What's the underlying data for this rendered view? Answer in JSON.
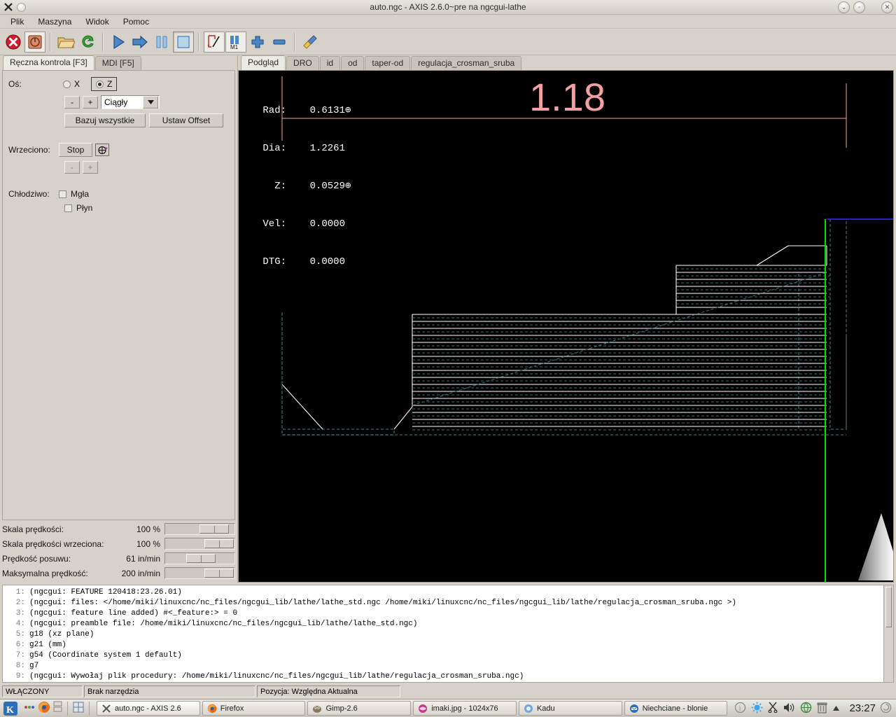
{
  "window": {
    "title": "auto.ngc - AXIS 2.6.0~pre na ngcgui-lathe",
    "buttons": {
      "shade": "⌄",
      "minimize": "◦",
      "close": "✕"
    }
  },
  "menu": {
    "items": [
      "Plik",
      "Maszyna",
      "Widok",
      "Pomoc"
    ]
  },
  "toolbar": {
    "items": [
      {
        "name": "estop-button",
        "label": "E-Stop"
      },
      {
        "name": "machine-power-button",
        "label": "Zasilanie"
      },
      {
        "name": "open-file-button",
        "label": "Otwórz"
      },
      {
        "name": "reload-file-button",
        "label": "Przeładuj"
      },
      {
        "name": "run-program-button",
        "label": "Start"
      },
      {
        "name": "step-program-button",
        "label": "Krok"
      },
      {
        "name": "pause-program-button",
        "label": "Pauza"
      },
      {
        "name": "stop-program-button",
        "label": "Stop"
      },
      {
        "name": "skip-lines-button",
        "label": "Pomiń linie"
      },
      {
        "name": "optional-stop-button",
        "label": "Opcjonalny stop"
      },
      {
        "name": "zoom-in-button",
        "label": "Powiększ"
      },
      {
        "name": "zoom-out-button",
        "label": "Pomniejsz"
      },
      {
        "name": "clear-plot-button",
        "label": "Wyczyść"
      }
    ]
  },
  "left_panel": {
    "tabs": [
      {
        "label": "Ręczna kontrola [F3]",
        "selected": true
      },
      {
        "label": "MDI [F5]",
        "selected": false
      }
    ],
    "axis": {
      "label": "Oś:",
      "options": [
        {
          "label": "X",
          "selected": false
        },
        {
          "label": "Z",
          "selected": true
        }
      ],
      "minus": "-",
      "plus": "+",
      "jog_mode": "Ciągły",
      "home_all": "Bazuj wszystkie",
      "set_offset": "Ustaw Offset"
    },
    "spindle": {
      "label": "Wrzeciono:",
      "stop": "Stop",
      "minus": "-",
      "plus": "+"
    },
    "coolant": {
      "label": "Chłodziwo:",
      "mist": "Mgła",
      "flood": "Płyn",
      "mist_checked": false,
      "flood_checked": false
    },
    "sliders": [
      {
        "name": "Skala prędkości:",
        "value": "100 %",
        "pct": 88
      },
      {
        "name": "Skala prędkości wrzeciona:",
        "value": "100 %",
        "pct": 100
      },
      {
        "name": "Prędkość posuwu:",
        "value": "61 in/min",
        "pct": 30
      },
      {
        "name": "Maksymalna prędkość:",
        "value": "200 in/min",
        "pct": 100
      }
    ]
  },
  "preview": {
    "tabs": [
      {
        "label": "Podgląd",
        "selected": true
      },
      {
        "label": "DRO",
        "selected": false
      },
      {
        "label": "id",
        "selected": false
      },
      {
        "label": "od",
        "selected": false
      },
      {
        "label": "taper-od",
        "selected": false
      },
      {
        "label": "regulacja_crosman_sruba",
        "selected": false
      }
    ],
    "dro": {
      "rows": [
        {
          "label": "Rad:",
          "value": "0.6131",
          "marker": true
        },
        {
          "label": "Dia:",
          "value": "1.2261",
          "marker": false
        },
        {
          "label": "Z:",
          "value": "0.0529",
          "marker": true
        },
        {
          "label": "Vel:",
          "value": "0.0000",
          "marker": false
        },
        {
          "label": "DTG:",
          "value": "0.0000",
          "marker": false
        }
      ]
    },
    "annotations": [
      {
        "text": "1.18",
        "color": "#f2a0a0"
      }
    ],
    "colors": {
      "background": "#000000",
      "toolpath_feed": "#ffffff",
      "toolpath_rapid": "#3f6e6e",
      "extents": "#f2a0a0",
      "axis_z": "#00d000",
      "limit": "#2020c0",
      "tool_cone": "#c8c8c8"
    }
  },
  "gcode": {
    "lines": [
      {
        "n": "1:",
        "text": "(ngcgui: FEATURE 120418:23.26.01)"
      },
      {
        "n": "2:",
        "text": "(ngcgui: files: </home/miki/linuxcnc/nc_files/ngcgui_lib/lathe/lathe_std.ngc /home/miki/linuxcnc/nc_files/ngcgui_lib/lathe/regulacja_crosman_sruba.ngc >)"
      },
      {
        "n": "3:",
        "text": "(ngcgui: feature line added) #<_feature:> = 0"
      },
      {
        "n": "4:",
        "text": "(ngcgui: preamble file: /home/miki/linuxcnc/nc_files/ngcgui_lib/lathe/lathe_std.ngc)"
      },
      {
        "n": "5:",
        "text": "g18 (xz plane)"
      },
      {
        "n": "6:",
        "text": "g21 (mm)"
      },
      {
        "n": "7:",
        "text": "g54 (Coordinate system 1 default)"
      },
      {
        "n": "8:",
        "text": "g7"
      },
      {
        "n": "9:",
        "text": "(ngcgui: Wywołaj plik procedury: /home/miki/linuxcnc/nc_files/ngcgui_lib/lathe/regulacja_crosman_sruba.ngc)"
      }
    ]
  },
  "statusbar": {
    "state": "WŁĄCZONY",
    "tool": "Brak narzędzia",
    "position": "Pozycja: Względna Aktualna"
  },
  "taskbar": {
    "start_label": "K",
    "tasks": [
      {
        "label": "auto.ngc - AXIS 2.6",
        "icon": "axis-icon",
        "active": true
      },
      {
        "label": "Firefox",
        "icon": "firefox-icon",
        "active": false
      },
      {
        "label": "Gimp-2.6",
        "icon": "gimp-icon",
        "active": false
      },
      {
        "label": "imaki.jpg - 1024x76",
        "icon": "image-icon",
        "active": false
      },
      {
        "label": "Kadu",
        "icon": "kadu-icon",
        "active": false
      },
      {
        "label": "Niechciane - blonie",
        "icon": "mail-icon",
        "active": false
      }
    ],
    "clock": "23:27"
  }
}
